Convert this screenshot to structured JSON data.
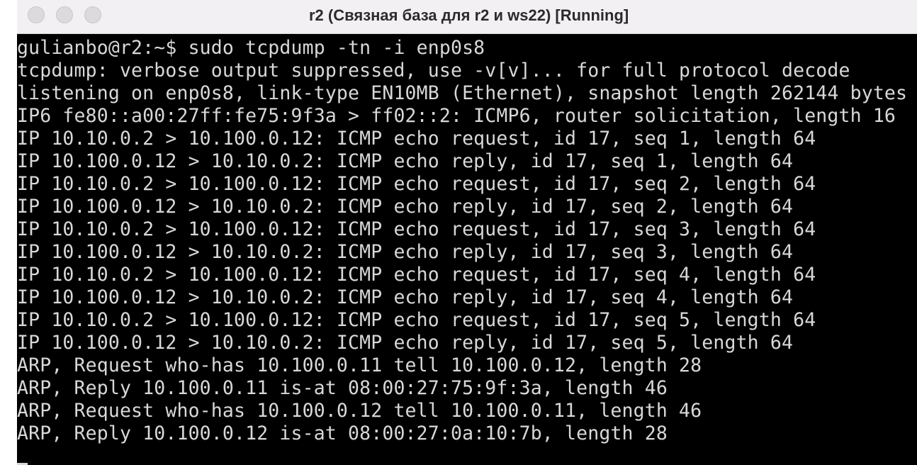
{
  "window": {
    "title": "r2 (Связная база для r2 и ws22) [Running]"
  },
  "terminal": {
    "lines": [
      "gulianbo@r2:~$ sudo tcpdump -tn -i enp0s8",
      "tcpdump: verbose output suppressed, use -v[v]... for full protocol decode",
      "listening on enp0s8, link-type EN10MB (Ethernet), snapshot length 262144 bytes",
      "IP6 fe80::a00:27ff:fe75:9f3a > ff02::2: ICMP6, router solicitation, length 16",
      "IP 10.10.0.2 > 10.100.0.12: ICMP echo request, id 17, seq 1, length 64",
      "IP 10.100.0.12 > 10.10.0.2: ICMP echo reply, id 17, seq 1, length 64",
      "IP 10.10.0.2 > 10.100.0.12: ICMP echo request, id 17, seq 2, length 64",
      "IP 10.100.0.12 > 10.10.0.2: ICMP echo reply, id 17, seq 2, length 64",
      "IP 10.10.0.2 > 10.100.0.12: ICMP echo request, id 17, seq 3, length 64",
      "IP 10.100.0.12 > 10.10.0.2: ICMP echo reply, id 17, seq 3, length 64",
      "IP 10.10.0.2 > 10.100.0.12: ICMP echo request, id 17, seq 4, length 64",
      "IP 10.100.0.12 > 10.10.0.2: ICMP echo reply, id 17, seq 4, length 64",
      "IP 10.10.0.2 > 10.100.0.12: ICMP echo request, id 17, seq 5, length 64",
      "IP 10.100.0.12 > 10.10.0.2: ICMP echo reply, id 17, seq 5, length 64",
      "ARP, Request who-has 10.100.0.11 tell 10.100.0.12, length 28",
      "ARP, Reply 10.100.0.11 is-at 08:00:27:75:9f:3a, length 46",
      "ARP, Request who-has 10.100.0.12 tell 10.100.0.11, length 46",
      "ARP, Reply 10.100.0.12 is-at 08:00:27:0a:10:7b, length 28"
    ]
  },
  "colors": {
    "terminal_background": "#000000",
    "terminal_text": "#d8d8d8",
    "titlebar_background": "#f2f0f3",
    "traffic_light_inactive": "#dcdadd"
  }
}
